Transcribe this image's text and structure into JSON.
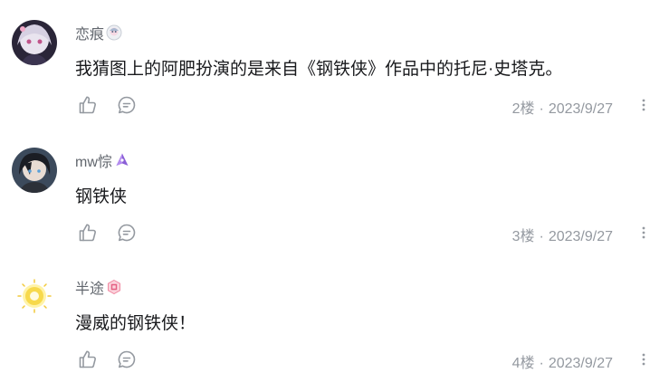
{
  "comments": [
    {
      "username": "恋痕",
      "badge_icon": "anime-badge-icon",
      "avatar_icon": "anime-girl-avatar",
      "content": "我猜图上的阿肥扮演的是来自《钢铁侠》作品中的托尼·史塔克。",
      "floor": "2楼",
      "separator": "·",
      "date": "2023/9/27"
    },
    {
      "username": "mw悰",
      "badge_icon": "purple-gem-badge-icon",
      "avatar_icon": "dark-hair-character-avatar",
      "content": "钢铁侠",
      "floor": "3楼",
      "separator": "·",
      "date": "2023/9/27"
    },
    {
      "username": "半途",
      "badge_icon": "pink-hexagon-badge-icon",
      "avatar_icon": "yellow-light-avatar",
      "content": "漫威的钢铁侠！",
      "floor": "4楼",
      "separator": "·",
      "date": "2023/9/27"
    }
  ],
  "icons": {
    "like": "thumbs-up-icon",
    "reply": "reply-bubble-icon",
    "more": "more-vertical-icon"
  },
  "colors": {
    "username": "#61666d",
    "content": "#18191c",
    "meta": "#9499a0",
    "icon": "#9499a0"
  }
}
